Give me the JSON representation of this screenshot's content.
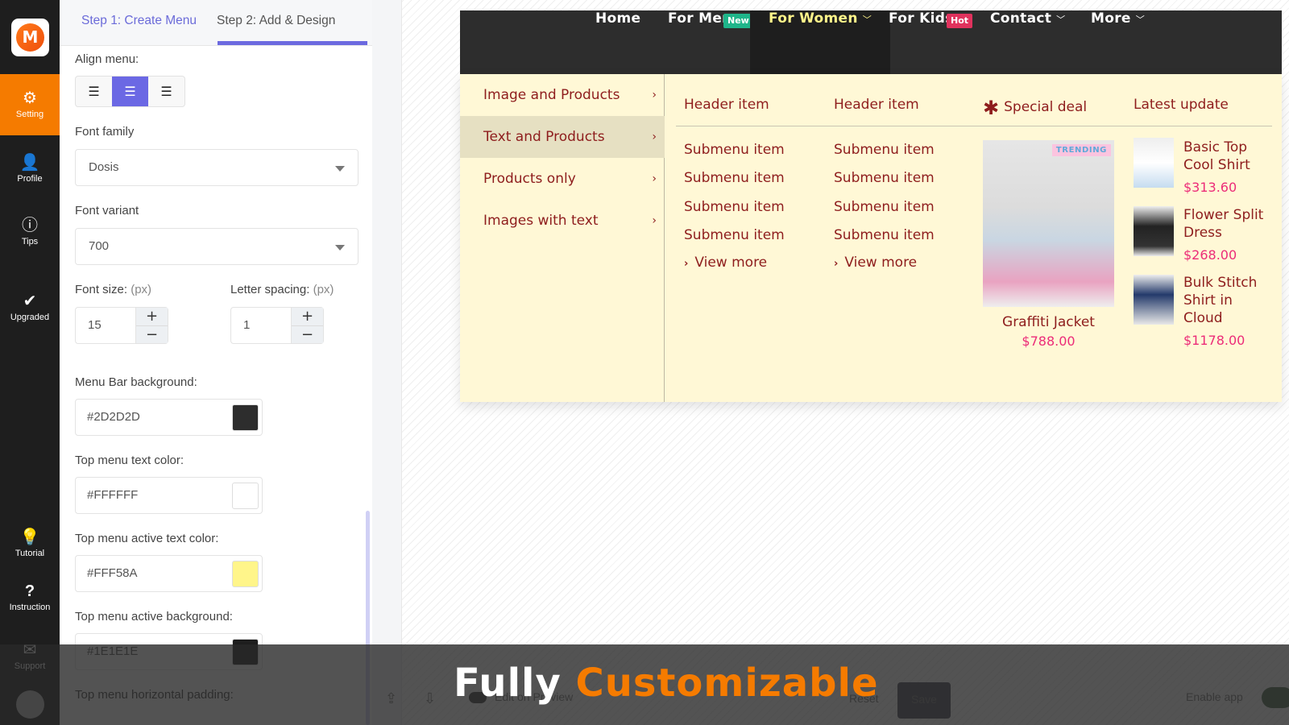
{
  "rail": {
    "logo_letter": "M",
    "items": [
      {
        "label": "Setting",
        "icon": "gear-icon",
        "active": true
      },
      {
        "label": "Profile",
        "icon": "user-icon"
      },
      {
        "label": "Tips",
        "icon": "info-icon"
      },
      {
        "label": "Upgraded",
        "icon": "check-icon"
      },
      {
        "label": "Tutorial",
        "icon": "lightbulb-icon"
      },
      {
        "label": "Instruction",
        "icon": "question-icon"
      },
      {
        "label": "Support",
        "icon": "mail-icon"
      }
    ]
  },
  "tabs": {
    "step1": "Step 1: Create Menu",
    "step2": "Step 2: Add & Design"
  },
  "settings": {
    "align_label": "Align menu:",
    "align_options": [
      "left",
      "center",
      "right"
    ],
    "align_selected": "center",
    "font_family_label": "Font family",
    "font_family": "Dosis",
    "font_variant_label": "Font variant",
    "font_variant": "700",
    "font_size_label": "Font size:",
    "letter_spacing_label": "Letter spacing:",
    "unit": "(px)",
    "font_size": "15",
    "letter_spacing": "1",
    "menubar_bg_label": "Menu Bar background:",
    "menubar_bg": "#2D2D2D",
    "top_text_label": "Top menu text color:",
    "top_text": "#FFFFFF",
    "active_text_label": "Top menu active text color:",
    "active_text": "#FFF58A",
    "active_bg_label": "Top menu active background:",
    "active_bg": "#1E1E1E",
    "h_padding_label": "Top menu horizontal padding:"
  },
  "menu": {
    "items": [
      {
        "label": "Home"
      },
      {
        "label": "For Men",
        "badge": "New",
        "badge_color": "#1fb58a"
      },
      {
        "label": "For Women",
        "active": true
      },
      {
        "label": "For Kids",
        "badge": "Hot",
        "badge_color": "#e0325d"
      },
      {
        "label": "Contact"
      },
      {
        "label": "More"
      }
    ],
    "left_list": [
      "Image and Products",
      "Text and Products",
      "Products only",
      "Images with text"
    ],
    "left_selected": 1,
    "columns": [
      {
        "header": "Header item",
        "items": [
          "Submenu item",
          "Submenu item",
          "Submenu item",
          "Submenu item"
        ],
        "view_more": "View more"
      },
      {
        "header": "Header item",
        "items": [
          "Submenu item",
          "Submenu item",
          "Submenu item",
          "Submenu item"
        ],
        "view_more": "View more"
      }
    ],
    "special": {
      "header": "Special deal",
      "badge": "TRENDING",
      "name": "Graffiti Jacket",
      "price": "$788.00"
    },
    "latest": {
      "header": "Latest update",
      "products": [
        {
          "name": "Basic Top Cool Shirt",
          "price": "$313.60"
        },
        {
          "name": "Flower Split Dress",
          "price": "$268.00"
        },
        {
          "name": "Bulk Stitch Shirt in Cloud",
          "price": "$1178.00"
        }
      ]
    }
  },
  "footer": {
    "edit_preview": "Edit on Preview",
    "reset": "Reset",
    "save": "Save",
    "enable_app": "Enable app"
  },
  "overlay": {
    "word1": "Fully",
    "word2": "Customizable"
  }
}
